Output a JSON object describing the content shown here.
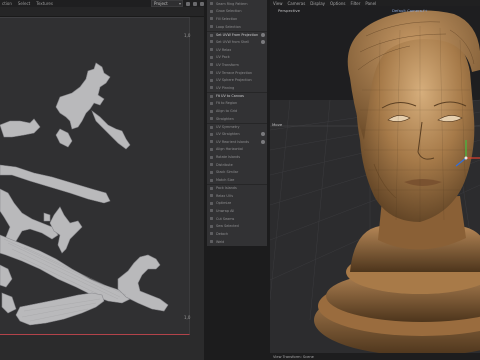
{
  "uv_panel": {
    "menu": [
      "ction",
      "Select",
      "Textures"
    ],
    "dropdown_value": "Project",
    "corner_top_right": "1,0",
    "corner_bottom_right": "1,0"
  },
  "command_panel": {
    "items": [
      {
        "label": "Seam Ring Pattern",
        "sep": false
      },
      {
        "label": "Grow Selection",
        "sep": false
      },
      {
        "label": "Fill Selection",
        "sep": false
      },
      {
        "label": "Loop Selection",
        "sep": false
      },
      {
        "label": "Set UVW From Projection",
        "sep": true,
        "bold": true,
        "gear": true
      },
      {
        "label": "Set UVW from Shell",
        "sep": false,
        "gear": true
      },
      {
        "label": "UV Relax",
        "sep": false
      },
      {
        "label": "UV Pack",
        "sep": false
      },
      {
        "label": "UV Transform",
        "sep": false
      },
      {
        "label": "UV Terrace Projection",
        "sep": false
      },
      {
        "label": "UV Sphere Projection",
        "sep": false
      },
      {
        "label": "UV Pinning",
        "sep": false
      },
      {
        "label": "Fit UV to Canvas",
        "sep": true,
        "bold": true
      },
      {
        "label": "Fit to Region",
        "sep": false
      },
      {
        "label": "Align to Grid",
        "sep": false
      },
      {
        "label": "Straighten",
        "sep": false
      },
      {
        "label": "UV Symmetry",
        "sep": true
      },
      {
        "label": "UV Straighten",
        "sep": false,
        "gear": true
      },
      {
        "label": "UV Reorient Islands",
        "sep": false,
        "gear": true
      },
      {
        "label": "Align Horizontal",
        "sep": false
      },
      {
        "label": "Rotate Islands",
        "sep": false
      },
      {
        "label": "Distribute",
        "sep": false
      },
      {
        "label": "Stack Similar",
        "sep": false
      },
      {
        "label": "Match Size",
        "sep": false
      },
      {
        "label": "Pack Islands",
        "sep": true
      },
      {
        "label": "Relax UVs",
        "sep": false
      },
      {
        "label": "Optimize",
        "sep": false
      },
      {
        "label": "Unwrap All",
        "sep": false
      },
      {
        "label": "Cut Seams",
        "sep": false
      },
      {
        "label": "Sew Selected",
        "sep": false
      },
      {
        "label": "Detach",
        "sep": false
      },
      {
        "label": "Weld",
        "sep": false
      }
    ]
  },
  "viewport": {
    "menu": [
      "View",
      "Cameras",
      "Display",
      "Options",
      "Filter",
      "Panel"
    ],
    "camera_label": "Default Camera.f+",
    "view_name": "Perspective",
    "move_label": "Move",
    "status": "View Transform: Scene"
  },
  "colors": {
    "uv_shell": "#b9b9bb",
    "uv_outline": "#8a8a8e",
    "uv_border_red": "#b3434a",
    "statue_light": "#c9a070",
    "statue_mid": "#9c7244",
    "statue_dark": "#5b3f22",
    "axis_x": "#e0412f",
    "axis_y": "#3fbf3f",
    "axis_z": "#2f6fe0"
  }
}
